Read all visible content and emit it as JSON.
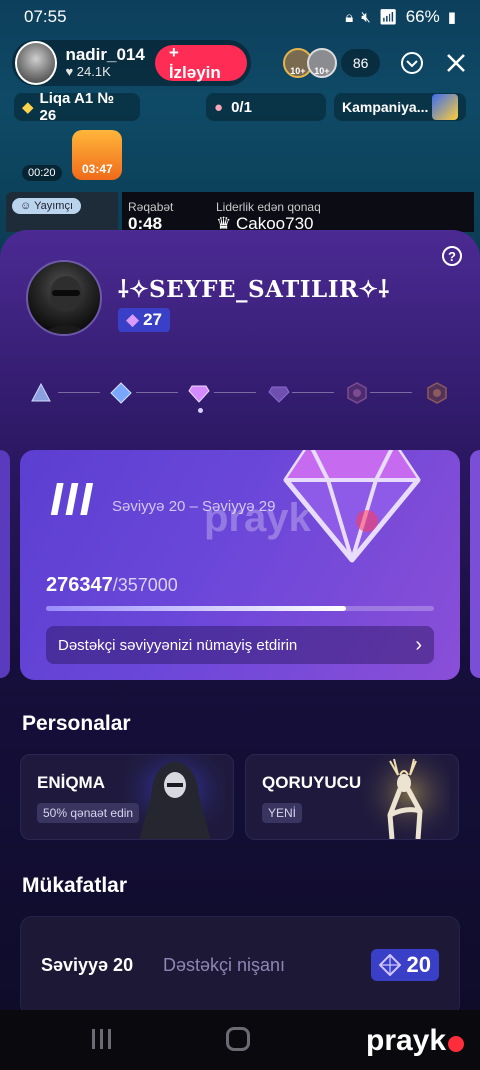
{
  "status_bar": {
    "time": "07:55",
    "battery": "66%"
  },
  "host": {
    "name": "nadir_014",
    "likes": "24.1K",
    "follow_label": "+ İzləyin"
  },
  "viewers": {
    "count": "86",
    "avatar_a": "10+",
    "avatar_b": "10+"
  },
  "league": {
    "label": "Liqa A1 № 26"
  },
  "poll": {
    "progress": "0/1"
  },
  "campaign": {
    "label": "Kampaniya..."
  },
  "gift": {
    "timer": "03:47",
    "clock": "00:20"
  },
  "battle": {
    "host_tag": "Yayımçı",
    "label": "Rəqabət",
    "time": "0:48",
    "lead_label": "Liderlik edən qonaq",
    "lead_name": "Cakoo730"
  },
  "profile": {
    "name": "⸸✧SEYFE_SATILIR✧⸸",
    "level": "27"
  },
  "tiers": [
    {
      "name": "tier-1",
      "color": "#8ca0e0"
    },
    {
      "name": "tier-2",
      "color": "#79a6ff"
    },
    {
      "name": "tier-3",
      "color": "#d38bff"
    },
    {
      "name": "tier-4",
      "color": "#6f4fb0"
    },
    {
      "name": "tier-5",
      "color": "#7c4b93"
    },
    {
      "name": "tier-6",
      "color": "#8a5a5e"
    }
  ],
  "level_card": {
    "roman": "III",
    "range": "Səviyyə 20 – Səviyyə 29",
    "current": "276347",
    "total": "/357000",
    "progress_fraction": 0.774,
    "show_label": "Dəstəkçi səviyyənizi nümayiş etdirin"
  },
  "personas_section": {
    "title": "Personalar"
  },
  "personas": [
    {
      "name": "ENİQMA",
      "tag": "50% qənaət edin"
    },
    {
      "name": "QORUYUCU",
      "tag": "YENİ"
    }
  ],
  "rewards_section": {
    "title": "Mükafatlar"
  },
  "reward": {
    "level": "Səviyyə 20",
    "desc": "Dəstəkçi nişanı",
    "badge": "20"
  },
  "watermark": {
    "text": "prayk"
  },
  "colors": {
    "accent": "#ff2d55",
    "badge": "#3a3fc7",
    "sheet_top": "#4b2a93"
  }
}
